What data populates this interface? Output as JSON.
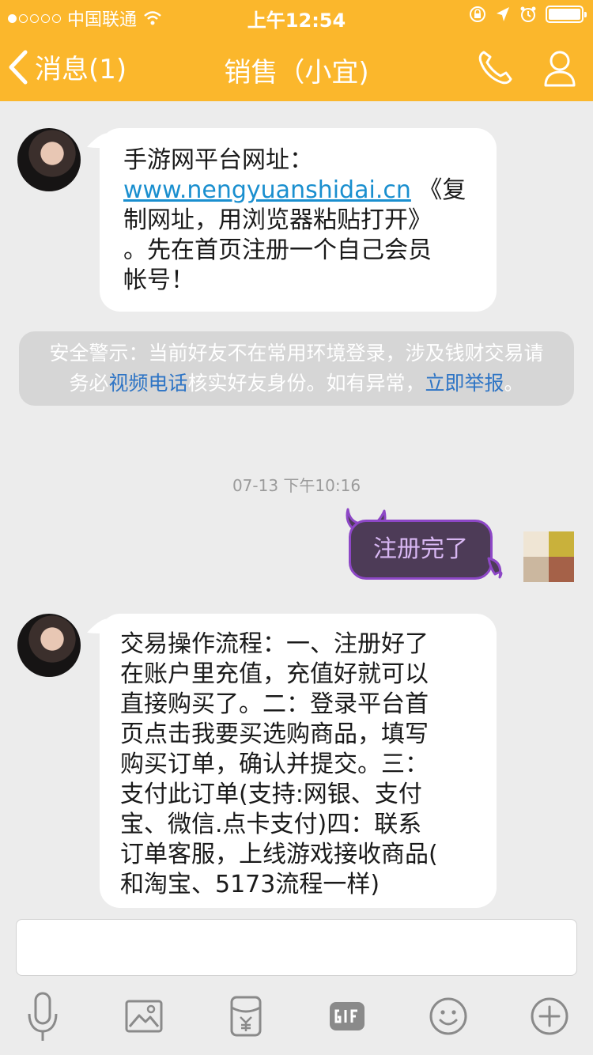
{
  "status_bar": {
    "carrier": "中国联通",
    "time": "上午12:54"
  },
  "nav": {
    "back_label": "消息(1)",
    "title": "销售（小宜)"
  },
  "messages": [
    {
      "line1": "手游网平台网址：",
      "link": "www.nengyuanshidai.cn",
      "after_link": " 《复",
      "line3": "制网址，用浏览器粘贴打开》",
      "line4": "。先在首页注册一个自己会员",
      "line5": "帐号！"
    },
    {
      "text": "注册完了"
    },
    {
      "lines": [
        "交易操作流程：一、注册好了",
        "在账户里充值，充值好就可以",
        "直接购买了。二：登录平台首",
        "页点击我要买选购商品，填写",
        "购买订单，确认并提交。三：",
        "支付此订单(支持:网银、支付",
        "宝、微信.点卡支付)四：联系",
        "订单客服，上线游戏接收商品(",
        "和淘宝、5173流程一样)"
      ]
    }
  ],
  "warning": {
    "part1": "安全警示：当前好友不在常用环境登录，涉及钱财交易请",
    "part2": "务必",
    "video_link": "视频电话",
    "part3": "核实好友身份。如有异常，",
    "report_link": "立即举报",
    "part4": "。"
  },
  "timestamp": "07-13 下午10:16",
  "toolbar_icons": [
    "microphone-icon",
    "image-icon",
    "red-packet-icon",
    "gif-icon",
    "emoji-icon",
    "plus-icon"
  ],
  "colors": {
    "header": "#fbb72c",
    "link": "#1a8fcf",
    "my_bubble": "#4d3b57",
    "my_bubble_border": "#8d47c6"
  }
}
